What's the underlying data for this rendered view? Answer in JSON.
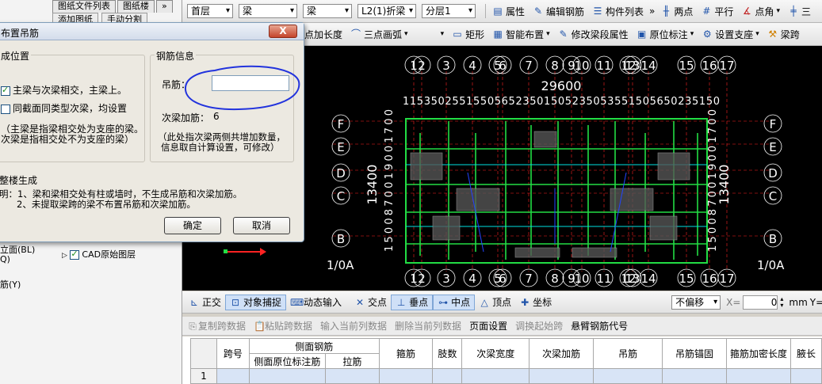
{
  "left_panel": {
    "tabs": [
      "图纸文件列表",
      "图纸楼"
    ],
    "buttons": [
      "添加图纸",
      "手动分割"
    ],
    "tree": [
      "立面(BL)",
      "Q)",
      "CAD原始图层",
      "筋(Y)"
    ]
  },
  "toolbar1": {
    "floor": "首层",
    "type1": "梁",
    "type2": "梁",
    "element": "L2(1)折梁",
    "layer": "分层1",
    "properties": "属性",
    "edit_rebar": "编辑钢筋",
    "component_list": "构件列表",
    "two_point": "两点",
    "parallel": "平行",
    "point_angle": "点角",
    "three": "三"
  },
  "toolbar2": {
    "extend": "点加长度",
    "three_point_arc": "三点画弧",
    "rectangle": "矩形",
    "smart_layout": "智能布置",
    "modify_segment": "修改梁段属性",
    "origin_label": "原位标注",
    "set_support": "设置支座",
    "beam_span": "梁跨"
  },
  "drawing": {
    "top_axes": [
      "1",
      "2",
      "3",
      "4",
      "5",
      "6",
      "7",
      "8",
      "9",
      "10",
      "11",
      "12",
      "13",
      "14",
      "15",
      "16",
      "17"
    ],
    "bottom_axes": [
      "1",
      "2",
      "3",
      "4",
      "5",
      "6",
      "7",
      "8",
      "9",
      "10",
      "11",
      "12",
      "13",
      "14",
      "15",
      "16",
      "17"
    ],
    "right_axes": [
      "F",
      "E",
      "D",
      "C",
      "B"
    ],
    "left_axes": [
      "F",
      "E",
      "D",
      "C",
      "B"
    ],
    "left_bottom_axis": "1/0A",
    "right_bottom_axis": "1/0A",
    "total_width": "29600",
    "total_height": "13400",
    "dim_row_top": "115350255155056523501505235053551505650235150",
    "dim_row_bottom": "115350255155056523501505235053551505650235150",
    "left_dims": "1500870019001700",
    "right_dims": "1500870019001700"
  },
  "snap_bar": {
    "ortho": "正交",
    "object_snap": "对象捕捉",
    "dynamic_input": "动态输入",
    "intersection": "交点",
    "perpendicular": "垂点",
    "midpoint": "中点",
    "vertex": "顶点",
    "coordinate": "坐标",
    "offset": "不偏移",
    "x_label": "X=",
    "x_value": "0",
    "unit_mm": "mm",
    "y_label": "Y="
  },
  "table_bar": {
    "copy_span": "复制跨数据",
    "paste_span": "粘贴跨数据",
    "input_column": "输入当前列数据",
    "delete_column": "删除当前列数据",
    "page_setup": "页面设置",
    "swap_start": "调换起始跨",
    "cantilever_code": "悬臂钢筋代号"
  },
  "table": {
    "headers_top": [
      "跨号",
      "侧面钢筋",
      "箍筋",
      "肢数",
      "次梁宽度",
      "次梁加筋",
      "吊筋",
      "吊筋锚固",
      "箍筋加密长度",
      "腋长"
    ],
    "headers_sub": [
      "侧面原位标注筋",
      "拉筋"
    ],
    "rows": [
      [
        "1",
        "",
        "",
        "",
        "",
        "",
        "",
        "",
        "",
        "",
        ""
      ]
    ]
  },
  "dialog": {
    "title": "布置吊筋",
    "close": "X",
    "gen_position": "成位置",
    "opt_main_secondary": "主梁与次梁相交，主梁上。",
    "opt_same_section": "同截面同类型次梁，均设置",
    "note_line1": "（主梁是指梁相交处为支座的梁。",
    "note_line2": "次梁是指相交处不为支座的梁）",
    "rebar_info": "钢筋信息",
    "hanger_label": "吊筋：",
    "hanger_value": "",
    "secondary_label": "次梁加筋：",
    "secondary_value": "6",
    "secondary_note1": "（此处指次梁两侧共增加数量，",
    "secondary_note2": "信息取自计算设置，可修改）",
    "whole_floor": "整楼生成",
    "explain1": "明：1、梁和梁相交处有柱或墙时，不生成吊筋和次梁加筋。",
    "explain2": "2、未提取梁跨的梁不布置吊筋和次梁加筋。",
    "ok": "确定",
    "cancel": "取消"
  },
  "colors": {
    "annotation": "#2233dd",
    "cad_bg": "#000000",
    "axis_white": "#ffffff",
    "wall_green": "#22dd44",
    "grid_red": "#ff2222",
    "beam_cyan": "#00e0e0"
  }
}
